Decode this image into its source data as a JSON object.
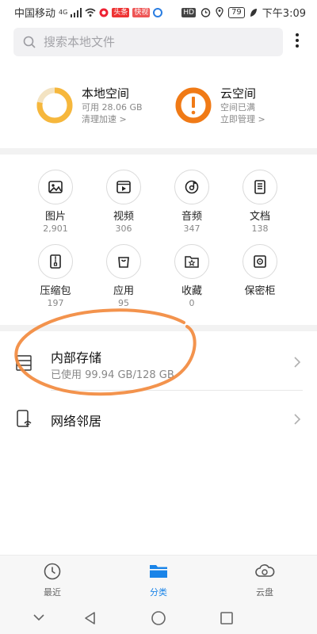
{
  "status_bar": {
    "carrier": "中国移动",
    "network": "4G",
    "time": "下午3:09",
    "battery": "79",
    "hd": "HD",
    "app_badge_1": "头条",
    "app_badge_2": "快视"
  },
  "search": {
    "placeholder": "搜索本地文件"
  },
  "local_space": {
    "title": "本地空间",
    "available": "可用 28.06 GB",
    "action": "清理加速 >",
    "used_fraction": 0.78
  },
  "cloud_space": {
    "title": "云空间",
    "status": "空间已满",
    "action": "立即管理 >"
  },
  "categories": [
    {
      "label": "图片",
      "count": "2,901",
      "icon": "image-icon"
    },
    {
      "label": "视频",
      "count": "306",
      "icon": "video-icon"
    },
    {
      "label": "音频",
      "count": "347",
      "icon": "audio-icon"
    },
    {
      "label": "文档",
      "count": "138",
      "icon": "document-icon"
    },
    {
      "label": "压缩包",
      "count": "197",
      "icon": "archive-icon"
    },
    {
      "label": "应用",
      "count": "95",
      "icon": "app-bag-icon"
    },
    {
      "label": "收藏",
      "count": "0",
      "icon": "favorite-icon"
    },
    {
      "label": "保密柜",
      "count": "",
      "icon": "safe-icon"
    }
  ],
  "internal_storage": {
    "title": "内部存储",
    "usage": "已使用 99.94 GB/128 GB"
  },
  "network_neighborhood": {
    "title": "网络邻居"
  },
  "tabs": [
    {
      "label": "最近",
      "icon": "clock-icon"
    },
    {
      "label": "分类",
      "icon": "folder-icon"
    },
    {
      "label": "云盘",
      "icon": "cloud-icon"
    }
  ],
  "colors": {
    "accent": "#1a84e8",
    "local_ring": "#f6b73c",
    "cloud_warning": "#f07a16",
    "annotation": "#f28a3e"
  }
}
